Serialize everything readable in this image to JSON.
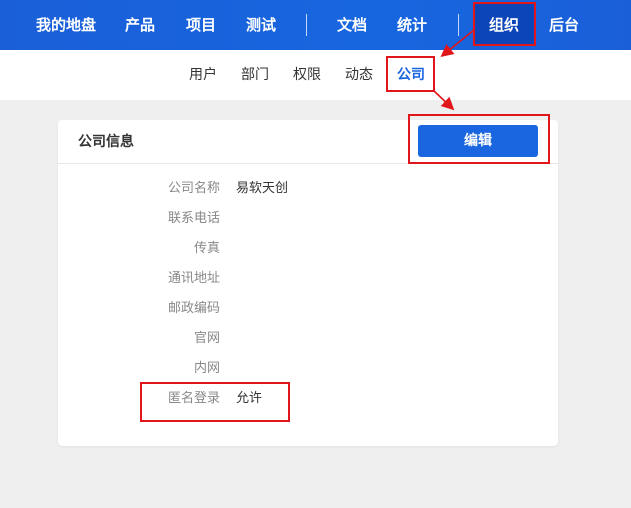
{
  "topnav": {
    "items": [
      {
        "label": "我的地盘"
      },
      {
        "label": "产品"
      },
      {
        "label": "项目"
      },
      {
        "label": "测试"
      },
      {
        "label": "文档"
      },
      {
        "label": "统计"
      },
      {
        "label": "组织"
      },
      {
        "label": "后台"
      }
    ],
    "active": "组织"
  },
  "subnav": {
    "items": [
      {
        "label": "用户"
      },
      {
        "label": "部门"
      },
      {
        "label": "权限"
      },
      {
        "label": "动态"
      },
      {
        "label": "公司"
      }
    ],
    "active": "公司"
  },
  "card": {
    "title": "公司信息",
    "edit_label": "编辑",
    "fields": [
      {
        "label": "公司名称",
        "value": "易软天创"
      },
      {
        "label": "联系电话",
        "value": ""
      },
      {
        "label": "传真",
        "value": ""
      },
      {
        "label": "通讯地址",
        "value": ""
      },
      {
        "label": "邮政编码",
        "value": ""
      },
      {
        "label": "官网",
        "value": ""
      },
      {
        "label": "内网",
        "value": ""
      },
      {
        "label": "匿名登录",
        "value": "允许"
      }
    ]
  },
  "colors": {
    "primary": "#1a66e0",
    "annotation": "#e0161b"
  }
}
